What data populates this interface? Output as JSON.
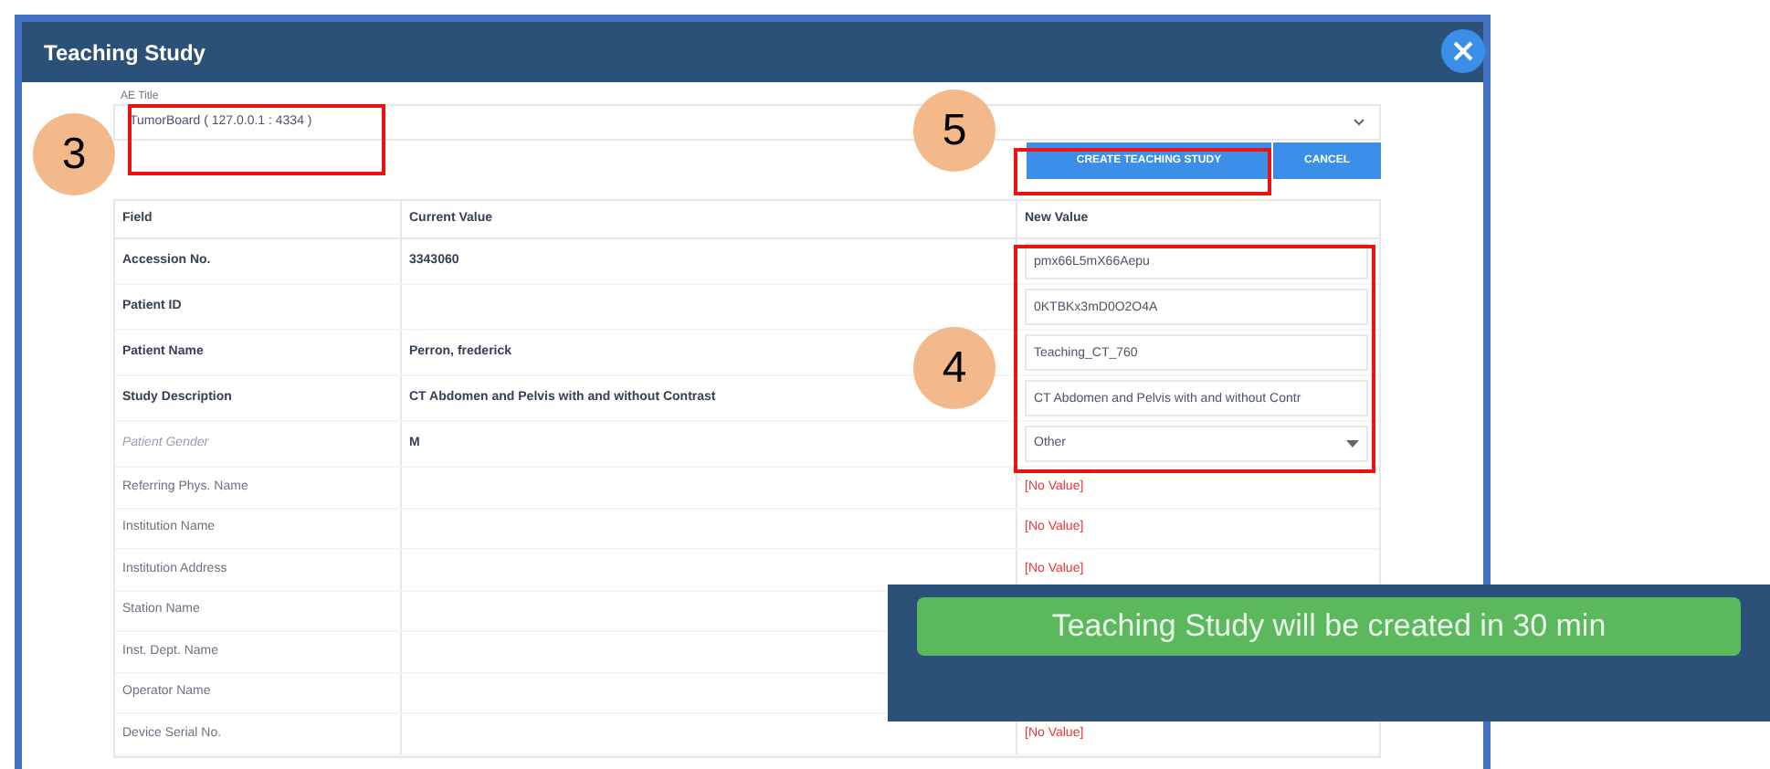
{
  "dialog": {
    "title": "Teaching Study"
  },
  "ae_title": {
    "label": "AE Title",
    "value": "TumorBoard ( 127.0.0.1 : 4334 )"
  },
  "buttons": [
    {
      "label": "CREATE TEACHING STUDY",
      "kind": "primary"
    },
    {
      "label": "CANCEL",
      "kind": "secondary"
    }
  ],
  "table": {
    "columns": [
      "Field",
      "Current Value",
      "New Value"
    ],
    "rows": [
      {
        "field": "Accession No.",
        "kind": "key",
        "current": "3343060",
        "new_value": {
          "kind": "text",
          "value": "pmx66L5mX66Aepu"
        }
      },
      {
        "field": "Patient ID",
        "kind": "key",
        "new_value": {
          "kind": "text",
          "value": "0KTBKx3mD0O2O4A"
        }
      },
      {
        "field": "Patient Name",
        "kind": "key",
        "current": "Perron, frederick",
        "new_value": {
          "kind": "text",
          "value": "Teaching_CT_760"
        }
      },
      {
        "field": "Study Description",
        "kind": "key",
        "current": "CT Abdomen and Pelvis with and without Contrast",
        "new_value": {
          "kind": "text",
          "value": "CT Abdomen and Pelvis with and without Contr"
        }
      },
      {
        "field": "Patient Gender",
        "kind": "choice",
        "current": "M",
        "new_value": {
          "kind": "select",
          "value": "Other"
        }
      },
      {
        "field": "Referring Phys. Name",
        "kind": "other",
        "new_value": {
          "kind": "empty",
          "value": "[No Value]"
        }
      },
      {
        "field": "Institution Name",
        "kind": "other",
        "new_value": {
          "kind": "empty",
          "value": "[No Value]"
        }
      },
      {
        "field": "Institution Address",
        "kind": "other",
        "new_value": {
          "kind": "empty",
          "value": "[No Value]"
        }
      },
      {
        "field": "Station Name",
        "kind": "other"
      },
      {
        "field": "Inst. Dept. Name",
        "kind": "other"
      },
      {
        "field": "Operator Name",
        "kind": "other"
      },
      {
        "field": "Device Serial No.",
        "kind": "other",
        "new_value": {
          "kind": "empty",
          "value": "[No Value]"
        }
      }
    ]
  },
  "toast": {
    "message": "Teaching Study will be created in 30 min"
  },
  "annotations": [
    {
      "label": "3"
    },
    {
      "label": "5"
    },
    {
      "label": "4"
    }
  ]
}
